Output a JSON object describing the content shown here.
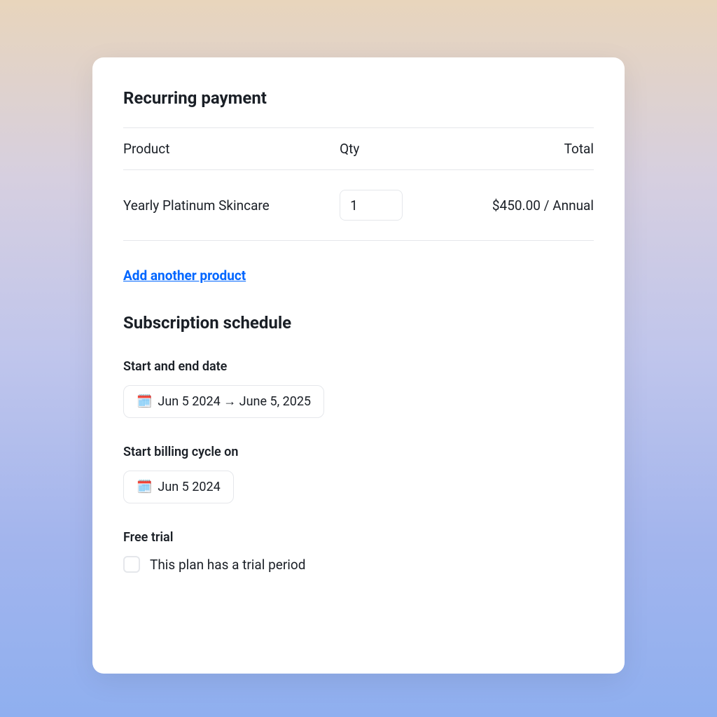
{
  "recurring_payment": {
    "title": "Recurring payment",
    "columns": {
      "product": "Product",
      "qty": "Qty",
      "total": "Total"
    },
    "items": [
      {
        "name": "Yearly Platinum Skincare",
        "qty": "1",
        "total": "$450.00 / Annual"
      }
    ],
    "add_link": "Add another product"
  },
  "schedule": {
    "title": "Subscription schedule",
    "start_end": {
      "label": "Start and end date",
      "value": "Jun 5 2024 → June 5, 2025"
    },
    "billing_cycle": {
      "label": "Start billing cycle on",
      "value": "Jun 5 2024"
    },
    "free_trial": {
      "label": "Free trial",
      "checkbox_label": "This plan has a trial period"
    }
  },
  "icons": {
    "calendar": "🗓️"
  }
}
